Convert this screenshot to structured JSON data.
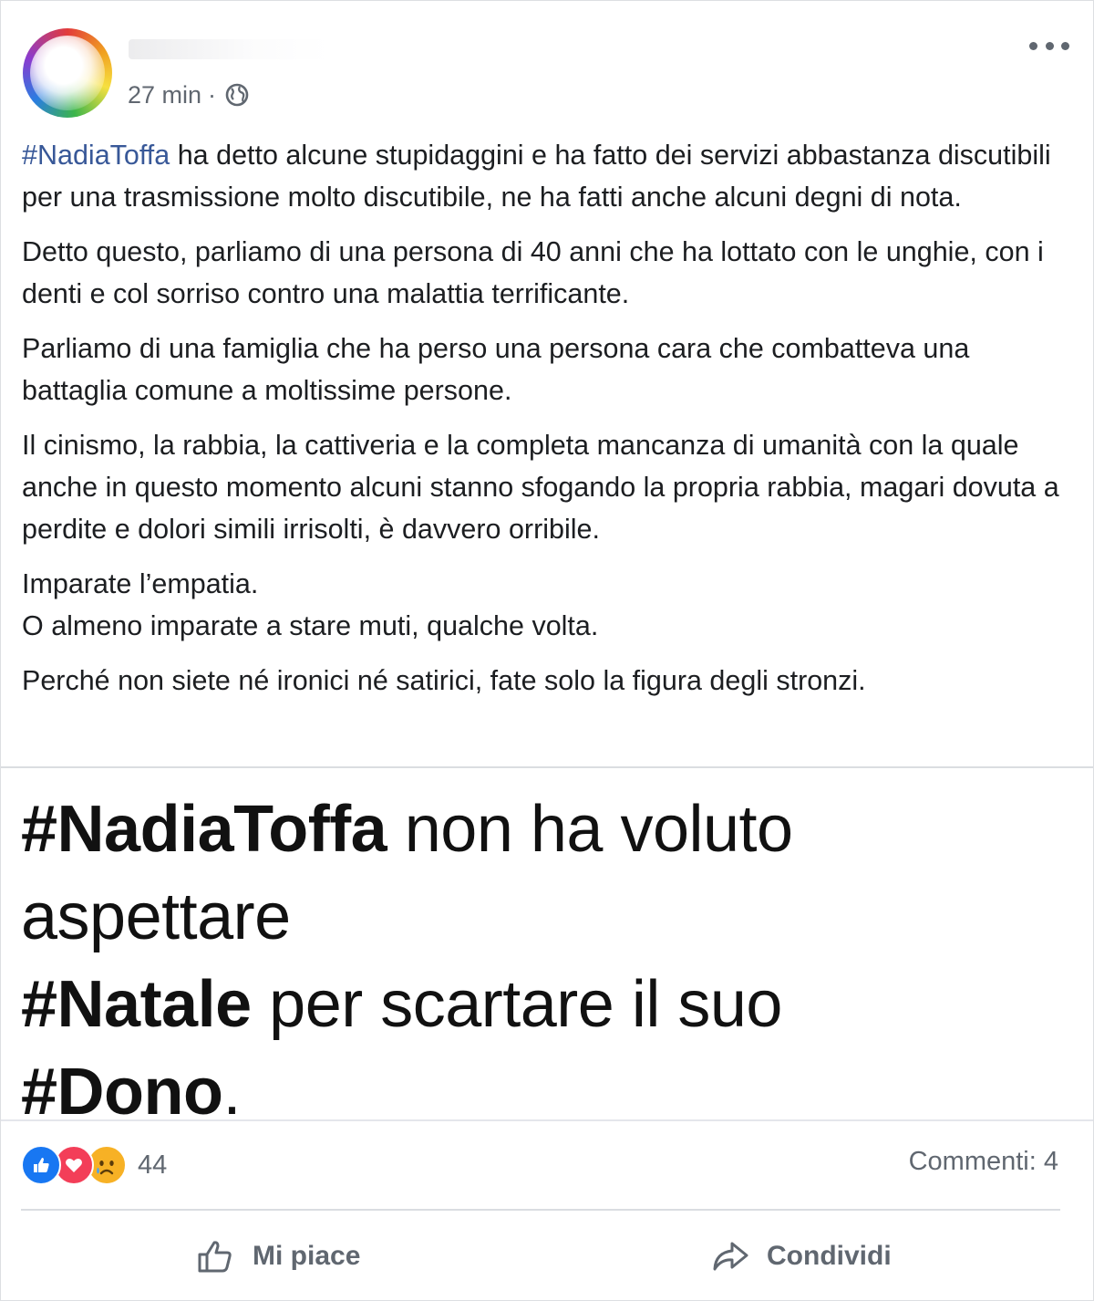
{
  "post": {
    "timestamp": "27 min",
    "separator": "·",
    "privacy_icon": "globe-icon",
    "menu_icon": "more-options-icon",
    "paragraphs": [
      {
        "hashtag": "#NadiaToffa",
        "text": " ha detto alcune stupidaggini e ha fatto dei servizi abbastanza discutibili per una trasmissione molto discutibile, ne ha fatti anche alcuni degni di nota."
      },
      {
        "text": "Detto questo, parliamo di una persona di 40 anni che ha lottato con le unghie, con i denti e col sorriso contro una malattia terrificante."
      },
      {
        "text": "Parliamo di una famiglia che ha perso una persona cara che combatteva una battaglia comune a moltissime persone."
      },
      {
        "text": "Il cinismo, la rabbia, la cattiveria e la completa mancanza di umanità con la quale anche in questo momento alcuni stanno sfogando la propria rabbia, magari dovuta a perdite e dolori simili irrisolti, è davvero orribile."
      },
      {
        "line1": "Imparate l’empatia.",
        "line2": "O almeno imparate a stare muti, qualche volta."
      },
      {
        "text": "Perché non siete né ironici né satirici, fate solo la figura degli stronzi."
      }
    ]
  },
  "image_text": {
    "tag1": "#NadiaToffa",
    "part1": " non ha voluto aspettare",
    "tag2": "#Natale",
    "part2": " per scartare il suo",
    "tag3": "#Dono",
    "part3": "."
  },
  "reactions": {
    "icons": [
      "like-reaction-icon",
      "love-reaction-icon",
      "sad-reaction-icon"
    ],
    "count": "44",
    "comments": "Commenti: 4",
    "colors": {
      "like": "#1877f2",
      "love": "#f33e58",
      "sad": "#f7b125"
    }
  },
  "actions": {
    "like_label": "Mi piace",
    "share_label": "Condividi"
  },
  "colors": {
    "hashtag": "#385898",
    "meta_text": "#606770"
  }
}
